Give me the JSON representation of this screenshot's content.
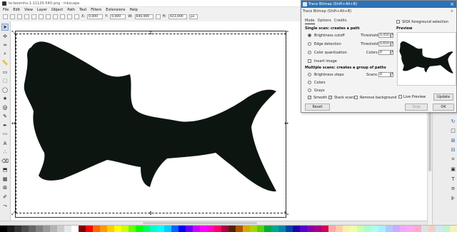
{
  "window": {
    "title": "te-boomhv-1-11120-540.png - Inkscape",
    "app_icon": "inkscape-icon"
  },
  "menu": [
    "File",
    "Edit",
    "View",
    "Layer",
    "Object",
    "Path",
    "Text",
    "Filters",
    "Extensions",
    "Help"
  ],
  "controls": {
    "x_label": "X:",
    "x_value": "0,000",
    "y_label": "Y:",
    "y_value": "0,000",
    "w_label": "W:",
    "w_value": "640,000",
    "h_label": "H:",
    "h_value": "423,000",
    "unit": "px"
  },
  "tools": [
    {
      "icon": "selector-icon",
      "glyph": "➤"
    },
    {
      "icon": "node-editor-icon",
      "glyph": "✢"
    },
    {
      "icon": "tweak-icon",
      "glyph": "≈"
    },
    {
      "icon": "zoom-icon",
      "glyph": "⌕"
    },
    {
      "icon": "measure-icon",
      "glyph": "📏"
    },
    {
      "icon": "rectangle-icon",
      "glyph": "▭"
    },
    {
      "icon": "3d-box-icon",
      "glyph": "⬚"
    },
    {
      "icon": "ellipse-icon",
      "glyph": "◯"
    },
    {
      "icon": "star-icon",
      "glyph": "★"
    },
    {
      "icon": "spiral-icon",
      "glyph": "@"
    },
    {
      "icon": "pencil-icon",
      "glyph": "✎"
    },
    {
      "icon": "pen-icon",
      "glyph": "✒"
    },
    {
      "icon": "calligraphy-icon",
      "glyph": "〰"
    },
    {
      "icon": "text-icon",
      "glyph": "A"
    },
    {
      "icon": "spray-icon",
      "glyph": "∴"
    },
    {
      "icon": "eraser-icon",
      "glyph": "⌫"
    },
    {
      "icon": "bucket-icon",
      "glyph": "⬒"
    },
    {
      "icon": "gradient-icon",
      "glyph": "▦"
    },
    {
      "icon": "mesh-icon",
      "glyph": "⊞"
    },
    {
      "icon": "dropper-icon",
      "glyph": "✐"
    },
    {
      "icon": "connector-icon",
      "glyph": "⤳"
    }
  ],
  "right_icons": [
    {
      "icon": "snap-toggle-icon",
      "glyph": "◩",
      "blue": false
    },
    {
      "icon": "snap-bbox-icon",
      "glyph": "▢",
      "blue": false
    },
    {
      "icon": "snap-edge-icon",
      "glyph": "⌐",
      "blue": false
    },
    {
      "icon": "snap-corner-icon",
      "glyph": "⌜",
      "blue": false
    },
    {
      "icon": "snap-node-icon",
      "glyph": "⊡",
      "blue": false
    },
    {
      "icon": "snap-path-icon",
      "glyph": "↗",
      "blue": false
    },
    {
      "icon": "snap-intersection-icon",
      "glyph": "✕",
      "blue": false
    },
    {
      "icon": "snap-smooth-icon",
      "glyph": "⁄",
      "blue": false
    },
    {
      "icon": "snap-midpoint-icon",
      "glyph": "⊹",
      "blue": false
    },
    {
      "icon": "snap-center-icon",
      "glyph": "⊕",
      "blue": true
    },
    {
      "icon": "snap-rotation-icon",
      "glyph": "↻",
      "blue": true
    },
    {
      "icon": "snap-page-icon",
      "glyph": "□",
      "blue": false
    },
    {
      "icon": "snap-grid-icon",
      "glyph": "⊞",
      "blue": true
    },
    {
      "icon": "snap-guide-icon",
      "glyph": "⊟",
      "blue": true
    },
    {
      "icon": "xml-editor-icon",
      "glyph": "⌗",
      "blue": false
    },
    {
      "icon": "fill-stroke-icon",
      "glyph": "▣",
      "blue": false
    },
    {
      "icon": "text-font-icon",
      "glyph": "T",
      "blue": false
    },
    {
      "icon": "layers-icon",
      "glyph": "≡",
      "blue": false
    },
    {
      "icon": "align-icon",
      "glyph": "⊪",
      "blue": false
    }
  ],
  "dialog": {
    "title": "Trace Bitmap (Shift+Alt+B)",
    "subtitle": "Trace Bitmap (Shift+Alt+B)",
    "tabs": [
      "Mode",
      "Options",
      "Credits"
    ],
    "single_scan_title": "Single scan: creates a path",
    "options": {
      "brightness": "Brightness cutoff",
      "edge": "Edge detection",
      "color_quant": "Color quantization",
      "invert": "Invert image"
    },
    "threshold_label": "Threshold:",
    "threshold_value": "0,450",
    "edge_threshold_label": "Threshold:",
    "edge_threshold_value": "0,650",
    "colors_label": "Colors:",
    "colors_value": "8",
    "multi_scan_title": "Multiple scans: creates a group of paths",
    "multi_options": {
      "brightness_steps": "Brightness steps",
      "colors": "Colors",
      "grays": "Grays"
    },
    "scans_label": "Scans:",
    "scans_value": "8",
    "smooth": "Smooth",
    "stack_scans": "Stack scans",
    "remove_background": "Remove background",
    "sioxtitle": "SIOX foreground selection",
    "preview_label": "Preview",
    "live_preview": "Live Preview",
    "update": "Update",
    "reset": "Reset",
    "stop": "Stop",
    "ok": "OK"
  },
  "palette_colors": [
    "#000000",
    "#1a1a1a",
    "#333333",
    "#4d4d4d",
    "#666666",
    "#808080",
    "#999999",
    "#b3b3b3",
    "#cccccc",
    "#e6e6e6",
    "#ffffff",
    "#800000",
    "#ff0000",
    "#ff6600",
    "#ff9900",
    "#ffcc00",
    "#ffff00",
    "#ccff00",
    "#66ff00",
    "#00ff00",
    "#00ff66",
    "#00ffcc",
    "#00ffff",
    "#00ccff",
    "#0066ff",
    "#0000ff",
    "#6600ff",
    "#cc00ff",
    "#ff00ff",
    "#ff00cc",
    "#ff0066",
    "#aa0044",
    "#552200",
    "#aa5500",
    "#d4aa00",
    "#aad400",
    "#55d400",
    "#00aa44",
    "#00aa88",
    "#0088aa",
    "#0044aa",
    "#2200aa",
    "#5500d4",
    "#8800aa",
    "#aa0088",
    "#d40055",
    "#ffaaaa",
    "#ffccaa",
    "#ffeeaa",
    "#eeffaa",
    "#ccffaa",
    "#aaffcc",
    "#aaffee",
    "#aaeeff",
    "#aaccff",
    "#ccaaff",
    "#eeaaff",
    "#ffaaee",
    "#ffaacc",
    "#e0e0e0",
    "#f2d0c0",
    "#d0e8f2",
    "#c0f2d0",
    "#f2f2c0"
  ]
}
